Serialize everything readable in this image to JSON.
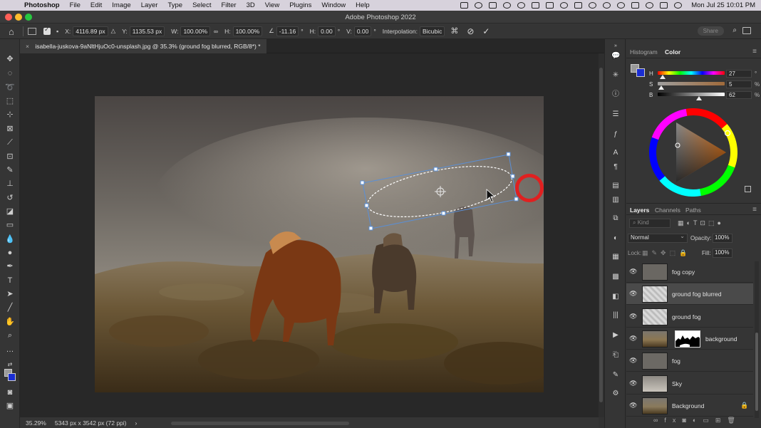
{
  "menubar": {
    "app_name": "Photoshop",
    "items": [
      "File",
      "Edit",
      "Image",
      "Layer",
      "Type",
      "Select",
      "Filter",
      "3D",
      "View",
      "Plugins",
      "Window",
      "Help"
    ],
    "clock": "Mon Jul 25  10:01 PM"
  },
  "window": {
    "title": "Adobe Photoshop 2022"
  },
  "options_bar": {
    "x_label": "X:",
    "x_value": "4116.89 px",
    "y_label": "Y:",
    "y_value": "1135.53 px",
    "w_label": "W:",
    "w_value": "100.00%",
    "h_label": "H:",
    "h_value": "100.00%",
    "angle_value": "-11.16",
    "hskew_label": "H:",
    "hskew_value": "0.00",
    "vskew_label": "V:",
    "vskew_value": "0.00",
    "degree_unit": "°",
    "interp_label": "Interpolation:",
    "interp_value": "Bicubic",
    "share_label": "Share"
  },
  "document": {
    "tab_title": "isabella-juskova-9aNltHjuOc0-unsplash.jpg @ 35.3% (ground fog blurred, RGB/8*) *"
  },
  "status": {
    "zoom": "35.29%",
    "doc_size": "5343 px x 3542 px (72 ppi)",
    "arrow": "›"
  },
  "color_panel": {
    "tabs": [
      "Histogram",
      "Color"
    ],
    "active_tab": "Color",
    "h_label": "H",
    "h_value": "27",
    "h_unit": "°",
    "s_label": "S",
    "s_value": "5",
    "s_unit": "%",
    "b_label": "B",
    "b_value": "62",
    "b_unit": "%",
    "h_level": 0.075,
    "s_level": 0.05,
    "b_level": 0.62,
    "foreground_color": "#9a9a9a",
    "background_color": "#1a2dd3"
  },
  "layers_panel": {
    "tabs": [
      "Layers",
      "Channels",
      "Paths"
    ],
    "active_tab": "Layers",
    "filter_placeholder": "Kind",
    "blend_mode": "Normal",
    "opacity_label": "Opacity:",
    "opacity_value": "100%",
    "lock_label": "Lock:",
    "fill_label": "Fill:",
    "fill_value": "100%",
    "layers": [
      {
        "name": "fog copy",
        "visible": true,
        "selected": false,
        "has_mask": false,
        "locked": false
      },
      {
        "name": "ground fog blurred",
        "visible": true,
        "selected": true,
        "has_mask": false,
        "locked": false
      },
      {
        "name": "ground fog",
        "visible": true,
        "selected": false,
        "has_mask": false,
        "locked": false
      },
      {
        "name": "background",
        "visible": true,
        "selected": false,
        "has_mask": true,
        "locked": false
      },
      {
        "name": "fog",
        "visible": true,
        "selected": false,
        "has_mask": false,
        "locked": false
      },
      {
        "name": "Sky",
        "visible": true,
        "selected": false,
        "has_mask": false,
        "locked": false
      },
      {
        "name": "Background",
        "visible": true,
        "selected": false,
        "has_mask": false,
        "locked": true
      }
    ]
  },
  "colors": {
    "selection_outline": "#5a8fd6",
    "cursor_ring": "#e02020",
    "selected_layer_bg": "#4a4a4a"
  },
  "icons": {
    "apple": "",
    "eye": "👁",
    "lock": "🔒",
    "home": "⌂",
    "search": "⌕",
    "cancel": "⊘",
    "commit": "✓",
    "panel_menu": "≡"
  }
}
